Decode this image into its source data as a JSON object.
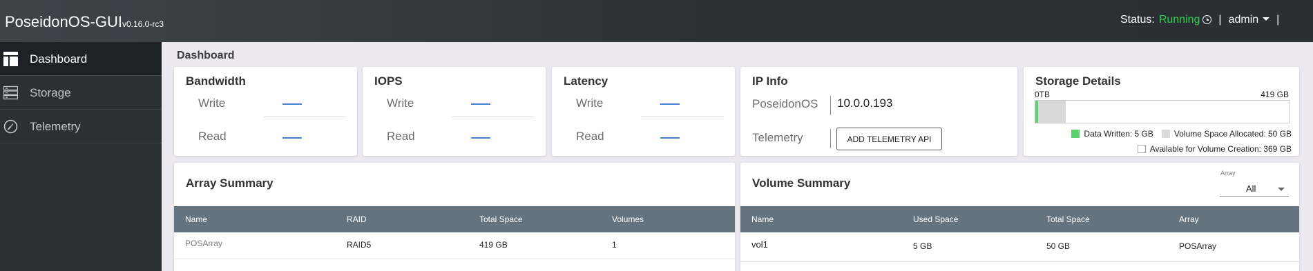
{
  "header": {
    "brand": "PoseidonOS-GUI",
    "version": "v0.16.0-rc3",
    "status_label": "Status:",
    "status_value": "Running",
    "separator": "|",
    "user": "admin",
    "status_color": "#2ed14a"
  },
  "sidebar": {
    "items": [
      {
        "label": "Dashboard",
        "icon": "dashboard-icon",
        "active": true
      },
      {
        "label": "Storage",
        "icon": "storage-icon",
        "active": false
      },
      {
        "label": "Telemetry",
        "icon": "telemetry-icon",
        "active": false
      }
    ]
  },
  "page": {
    "title": "Dashboard"
  },
  "metrics": {
    "write_label": "Write",
    "read_label": "Read",
    "cards": [
      {
        "title": "Bandwidth"
      },
      {
        "title": "IOPS"
      },
      {
        "title": "Latency"
      }
    ]
  },
  "ip_info": {
    "title": "IP Info",
    "poseidonos_label": "PoseidonOS",
    "poseidonos_value": "10.0.0.193",
    "telemetry_label": "Telemetry",
    "telemetry_button": "ADD TELEMETRY API"
  },
  "storage_details": {
    "title": "Storage Details",
    "min_label": "0TB",
    "max_label": "419 GB",
    "total_gb": 419,
    "written_gb": 5,
    "allocated_gb": 50,
    "available_gb": 369,
    "legend_written": "Data Written: 5 GB",
    "legend_allocated": "Volume Space Allocated: 50 GB",
    "legend_available": "Available for Volume Creation: 369 GB",
    "written_color": "#5bd26e",
    "allocated_color": "#d9d9d9"
  },
  "array_summary": {
    "title": "Array Summary",
    "columns": [
      "Name",
      "RAID",
      "Total Space",
      "Volumes"
    ],
    "rows": [
      {
        "name": "POSArray",
        "raid": "RAID5",
        "total_space": "419 GB",
        "volumes": "1"
      }
    ]
  },
  "volume_summary": {
    "title": "Volume Summary",
    "filter_label": "Array",
    "filter_value": "All",
    "columns": [
      "Name",
      "Used Space",
      "Total Space",
      "Array"
    ],
    "rows": [
      {
        "name": "vol1",
        "used_space": "5 GB",
        "total_space": "50 GB",
        "array": "POSArray"
      }
    ]
  }
}
